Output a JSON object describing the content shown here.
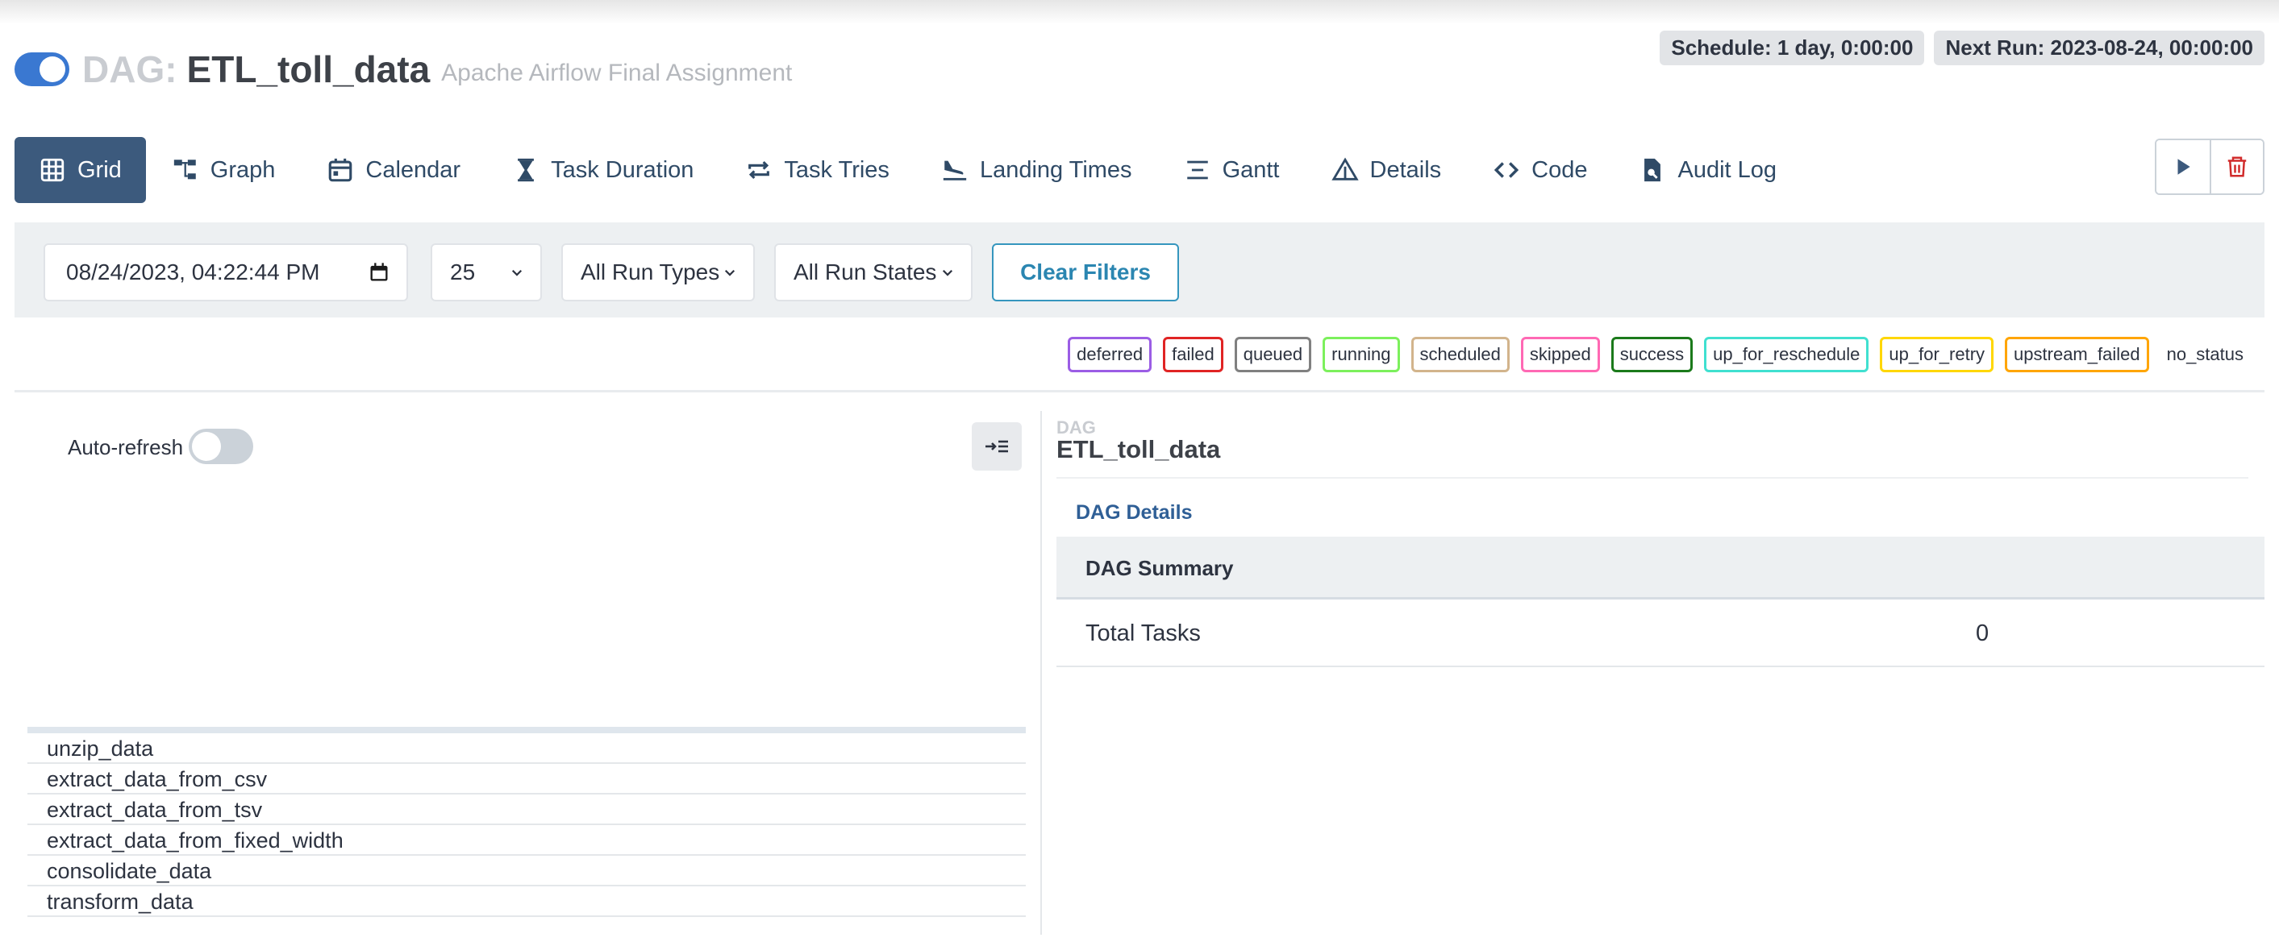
{
  "header": {
    "dag_prefix": "DAG:",
    "dag_id": "ETL_toll_data",
    "description": "Apache Airflow Final Assignment",
    "paused": false
  },
  "badges": {
    "schedule": "Schedule: 1 day, 0:00:00",
    "next_run": "Next Run: 2023-08-24, 00:00:00"
  },
  "nav": {
    "items": [
      {
        "label": "Grid",
        "icon": "grid-icon",
        "active": true
      },
      {
        "label": "Graph",
        "icon": "graph-icon"
      },
      {
        "label": "Calendar",
        "icon": "calendar-icon"
      },
      {
        "label": "Task Duration",
        "icon": "hourglass-icon"
      },
      {
        "label": "Task Tries",
        "icon": "repeat-icon"
      },
      {
        "label": "Landing Times",
        "icon": "plane-landing-icon"
      },
      {
        "label": "Gantt",
        "icon": "gantt-icon"
      },
      {
        "label": "Details",
        "icon": "warning-triangle-icon"
      },
      {
        "label": "Code",
        "icon": "code-icon"
      },
      {
        "label": "Audit Log",
        "icon": "audit-file-icon"
      }
    ]
  },
  "actions": {
    "trigger": "play-icon",
    "delete": "trash-icon"
  },
  "filters": {
    "base_date": "08/24/2023, 04:22:44 PM",
    "num_runs": "25",
    "run_type": "All Run Types",
    "run_state": "All Run States",
    "clear_label": "Clear Filters"
  },
  "legend": [
    {
      "label": "deferred",
      "color": "#9b5de5"
    },
    {
      "label": "failed",
      "color": "#e02424"
    },
    {
      "label": "queued",
      "color": "#808080"
    },
    {
      "label": "running",
      "color": "#7cf05c"
    },
    {
      "label": "scheduled",
      "color": "#d2b48c"
    },
    {
      "label": "skipped",
      "color": "#ff69b4"
    },
    {
      "label": "success",
      "color": "#1b7a1b"
    },
    {
      "label": "up_for_reschedule",
      "color": "#40e0d0"
    },
    {
      "label": "up_for_retry",
      "color": "#ffd700"
    },
    {
      "label": "upstream_failed",
      "color": "#ffa500"
    },
    {
      "label": "no_status",
      "color": ""
    }
  ],
  "grid": {
    "auto_refresh_label": "Auto-refresh",
    "auto_refresh_on": false,
    "tasks": [
      "unzip_data",
      "extract_data_from_csv",
      "extract_data_from_tsv",
      "extract_data_from_fixed_width",
      "consolidate_data",
      "transform_data"
    ]
  },
  "details": {
    "kicker": "DAG",
    "title": "ETL_toll_data",
    "tab": "DAG Details",
    "summary_heading": "DAG Summary",
    "rows": [
      {
        "key": "Total Tasks",
        "value": "0"
      }
    ]
  }
}
